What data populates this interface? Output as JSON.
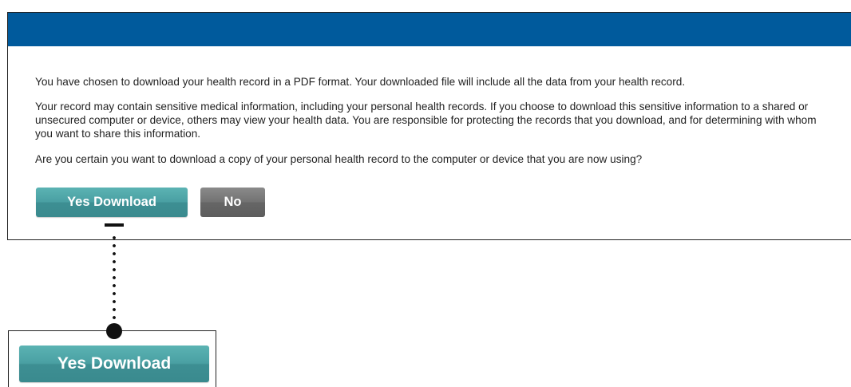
{
  "dialog": {
    "paragraphs": [
      "You have chosen to download your health record in a PDF format. Your downloaded file will include all the data from your health record.",
      "Your record may contain sensitive medical information, including your personal health records. If you choose to download this sensitive information to a shared or unsecured computer or device, others may view your health data. You are responsible for protecting the records that you download, and for determining with whom you want to share this information.",
      "Are you certain you want to download a copy of your personal health record to the computer or device that you are now using?"
    ],
    "yes_button_label": "Yes Download",
    "no_button_label": "No"
  },
  "callout": {
    "zoom_button_label": "Yes Download"
  },
  "colors": {
    "header": "#005a9c",
    "yes_button": "#4aa0a3",
    "no_button": "#6e6e6e"
  }
}
